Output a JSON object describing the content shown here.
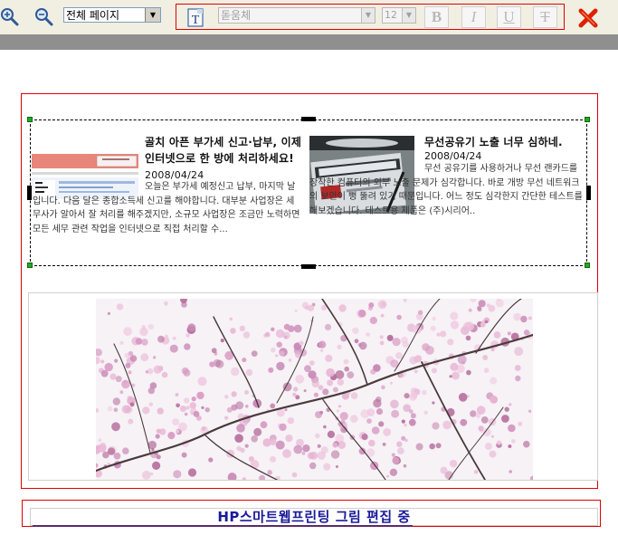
{
  "toolbar": {
    "zoom_in_icon": "zoom-in-icon",
    "zoom_out_icon": "zoom-out-icon",
    "page_select_value": "전체 페이지",
    "text_icon": "T",
    "font_select_value": "돋움체",
    "font_size_value": "12",
    "bold_label": "B",
    "italic_label": "I",
    "underline_label": "U",
    "strike_label": "T",
    "close_icon": "close-icon"
  },
  "articles": [
    {
      "title": "골치 아픈 부가세 신고·납부, 이제 인터넷으로 한 방에 처리하세요!",
      "date": "2008/04/24",
      "body": "오늘은 부가세 예정신고 납부, 마지막 날입니다. 다음 달은 종합소득세 신고를 해야합니다. 대부분 사업장은 세무사가 알아서 잘 처리를 해주겠지만, 소규모 사업장은 조금만 노력하면 모든 세무 관련 작업을 인터넷으로 직접 처리할 수..."
    },
    {
      "title": "무선공유기 노출 너무 심하네.",
      "date": "2008/04/24",
      "body": "무선 공유기를 사용하거나 무선 랜카드를 장착한 컴퓨터의 외부 노출 문제가 심각합니다. 바로 개방 무선 네트워크의 보안이 뻥 뚫려 있기 때문입니다. 어느 정도 심각한지 간단한 테스트를 해보겠습니다. 테스트용 제품은 (주)시리어.."
    }
  ],
  "status": {
    "text": "HP스마트웹프린팅 그림 편집 중"
  },
  "colors": {
    "toolbar_bg": "#f1efe2",
    "frame_red": "#e00000",
    "status_text": "#1a1a99",
    "close_red": "#dd2200"
  }
}
